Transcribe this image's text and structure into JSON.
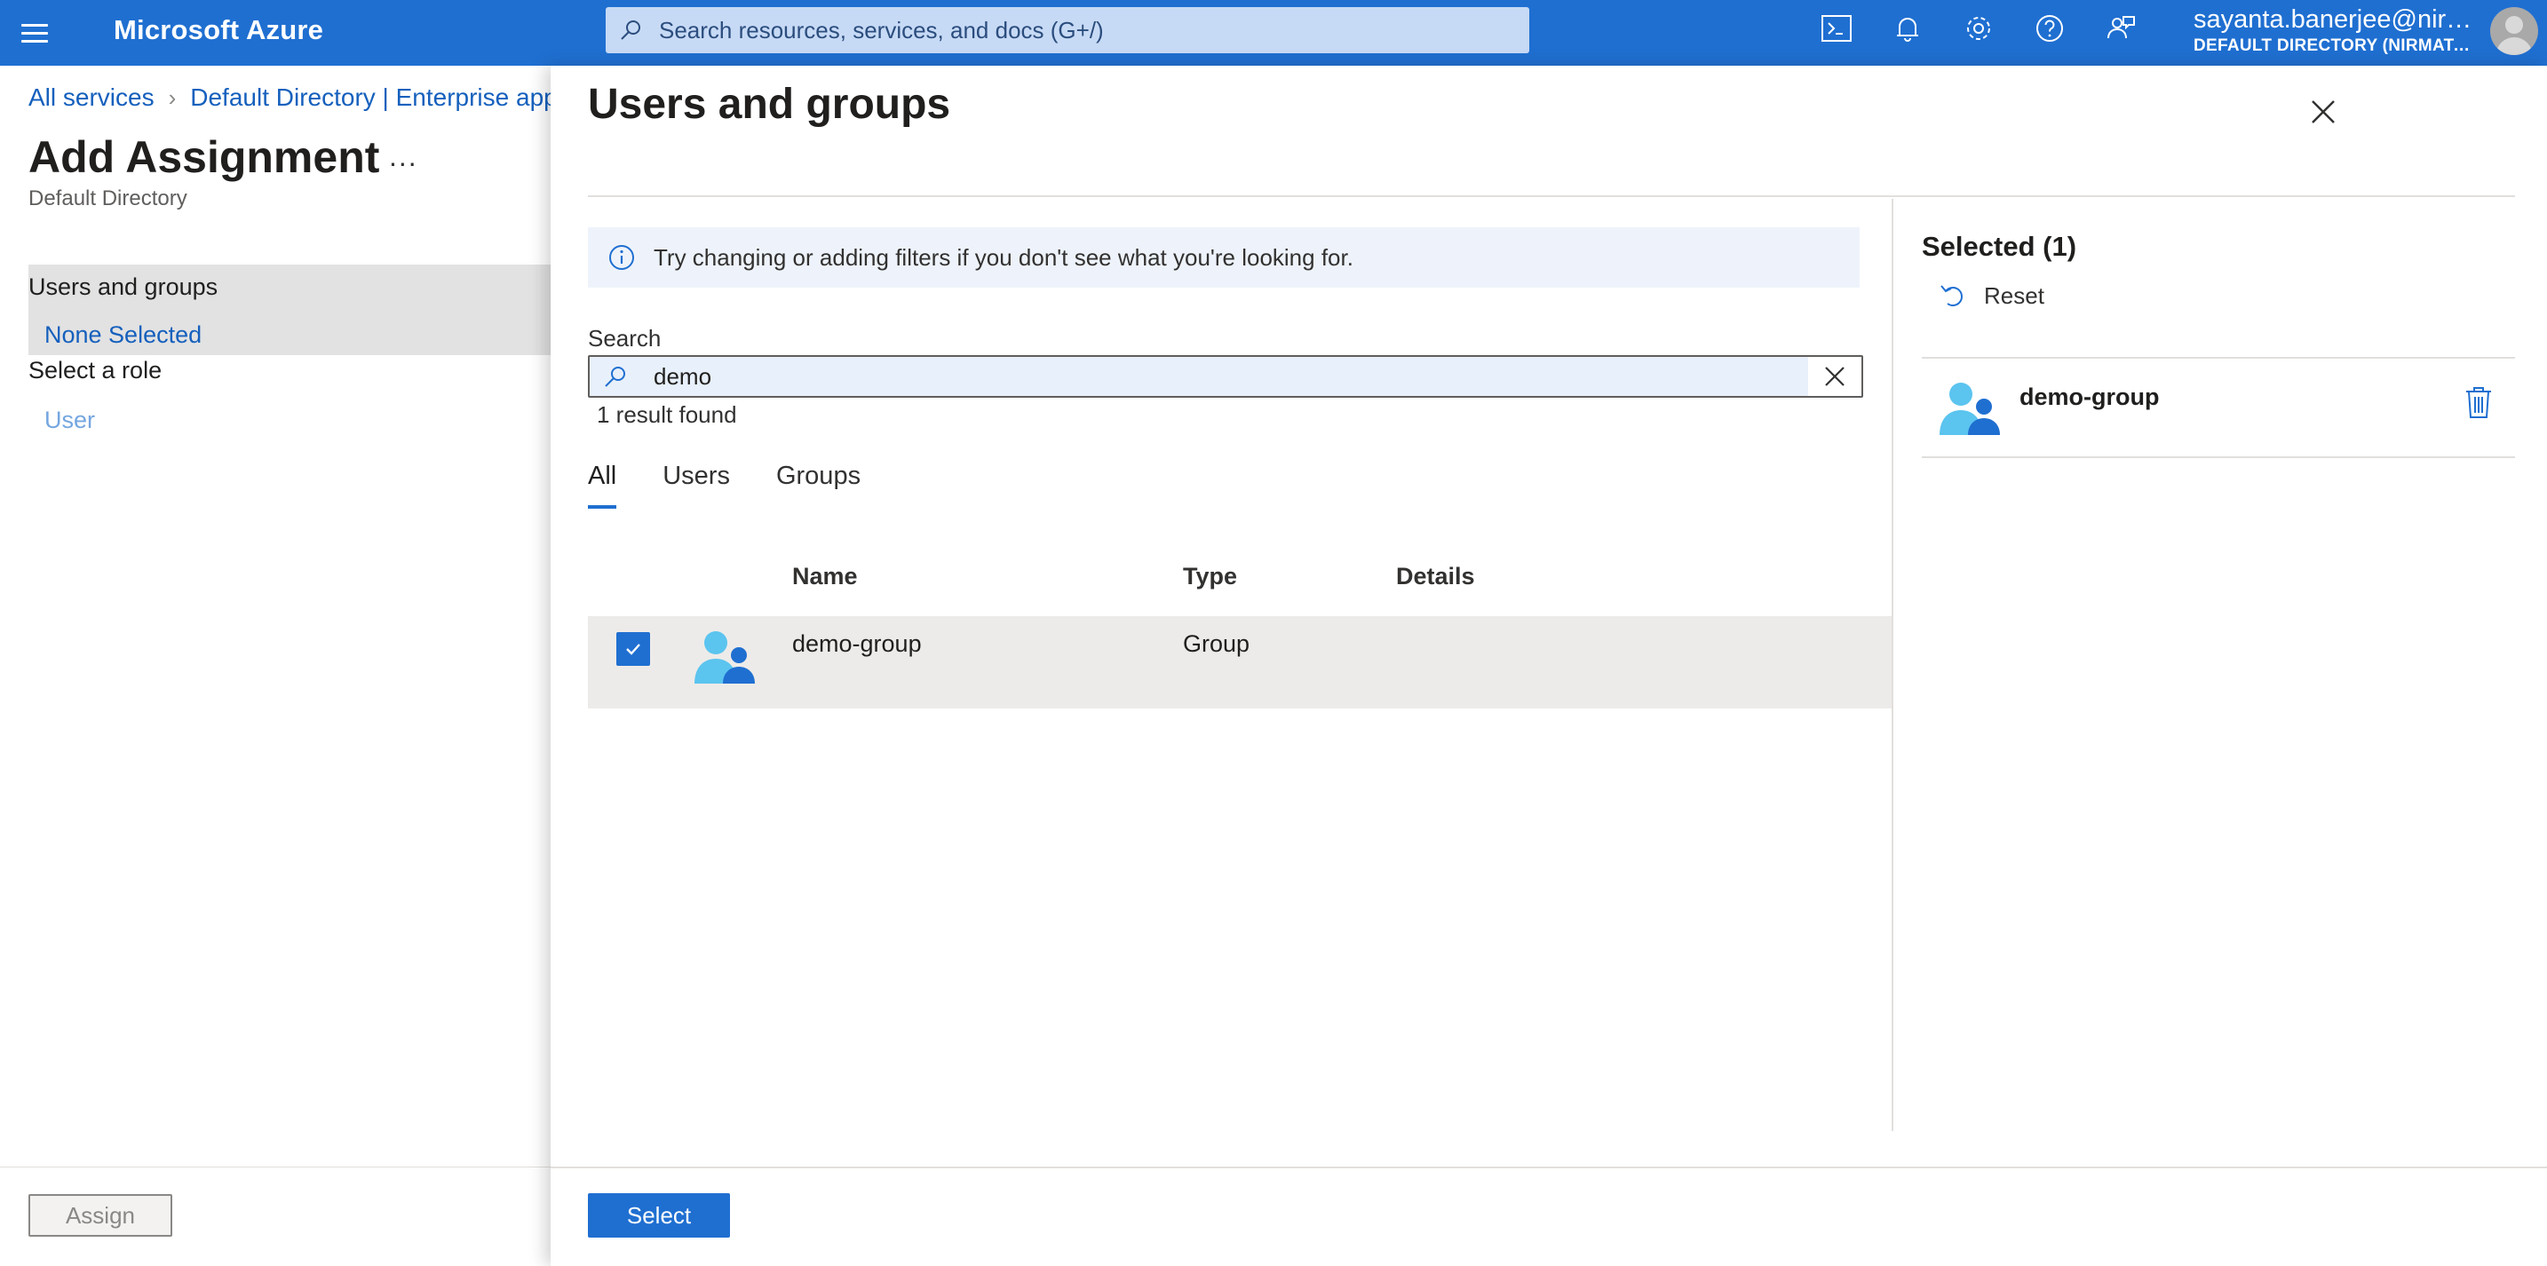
{
  "topbar": {
    "brand": "Microsoft Azure",
    "search_placeholder": "Search resources, services, and docs (G+/)",
    "account_name": "sayanta.banerjee@nirm...",
    "account_directory": "DEFAULT DIRECTORY (NIRMATA...",
    "icons": [
      "cloud-shell-icon",
      "bell-icon",
      "gear-icon",
      "help-icon",
      "feedback-icon"
    ]
  },
  "breadcrumb": {
    "items": [
      "All services",
      "Default Directory | Enterprise app"
    ]
  },
  "left_blade": {
    "title": "Add Assignment",
    "more": "...",
    "subtitle": "Default Directory",
    "users_groups_label": "Users and groups",
    "users_groups_value": "None Selected",
    "role_label": "Select a role",
    "role_value": "User",
    "assign_label": "Assign"
  },
  "panel": {
    "title": "Users and groups",
    "info_text": "Try changing or adding filters if you don't see what you're looking for.",
    "search_label": "Search",
    "search_value": "demo",
    "result_count": "1 result found",
    "tabs": [
      "All",
      "Users",
      "Groups"
    ],
    "active_tab": "All",
    "columns": [
      "Name",
      "Type",
      "Details"
    ],
    "rows": [
      {
        "name": "demo-group",
        "type": "Group",
        "details": "",
        "checked": true
      }
    ],
    "selected_title": "Selected (1)",
    "reset_label": "Reset",
    "selected_items": [
      "demo-group"
    ],
    "select_label": "Select"
  },
  "colors": {
    "brand_blue": "#1f6fd1",
    "link_blue": "#1560bd",
    "row_highlight": "#edebe9"
  }
}
